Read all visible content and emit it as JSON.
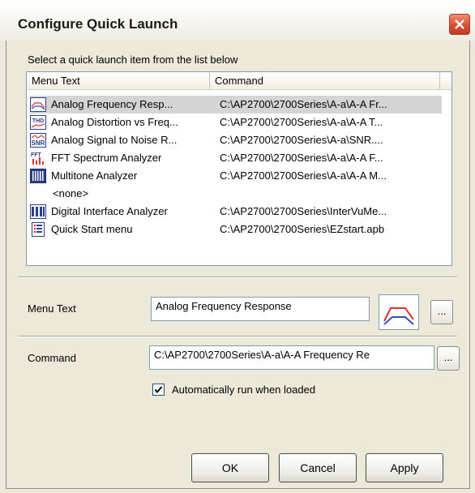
{
  "window": {
    "title": "Configure Quick Launch"
  },
  "list": {
    "caption": "Select a quick launch item from the list below",
    "columns": [
      "Menu Text",
      "Command"
    ],
    "items": [
      {
        "menu_text": "Analog Frequency Resp...",
        "command": "C:\\AP2700\\2700Series\\A-a\\A-A Fr...",
        "icon": "frequency-response-icon",
        "selected": true
      },
      {
        "menu_text": "Analog Distortion vs Freq...",
        "command": "C:\\AP2700\\2700Series\\A-a\\A-A T...",
        "icon": "thd-icon",
        "selected": false
      },
      {
        "menu_text": "Analog Signal to Noise R...",
        "command": "C:\\AP2700\\2700Series\\A-a\\SNR....",
        "icon": "snr-icon",
        "selected": false
      },
      {
        "menu_text": "FFT Spectrum Analyzer",
        "command": "C:\\AP2700\\2700Series\\A-a\\A-A F...",
        "icon": "fft-icon",
        "selected": false
      },
      {
        "menu_text": "Multitone Analyzer",
        "command": "C:\\AP2700\\2700Series\\A-a\\A-A M...",
        "icon": "multitone-icon",
        "selected": false
      },
      {
        "menu_text": "<none>",
        "command": "",
        "icon": "",
        "selected": false
      },
      {
        "menu_text": "Digital Interface Analyzer",
        "command": "C:\\AP2700\\2700Series\\InterVuMe...",
        "icon": "digital-interface-icon",
        "selected": false
      },
      {
        "menu_text": "Quick Start menu",
        "command": "C:\\AP2700\\2700Series\\EZstart.apb",
        "icon": "quick-start-icon",
        "selected": false
      }
    ]
  },
  "menu_text_field": {
    "label": "Menu Text",
    "value": "Analog Frequency Response",
    "browse_label": "..."
  },
  "command_field": {
    "label": "Command",
    "value": "C:\\AP2700\\2700Series\\A-a\\A-A Frequency Re",
    "browse_label": "..."
  },
  "auto_run": {
    "label": "Automatically run when loaded",
    "checked": true
  },
  "buttons": {
    "ok": "OK",
    "cancel": "Cancel",
    "apply": "Apply"
  },
  "colors": {
    "dialog_bg": "#ece9d8",
    "list_border": "#7f9db9",
    "selection": "#d4d4d4",
    "close_red": "#d65030"
  }
}
